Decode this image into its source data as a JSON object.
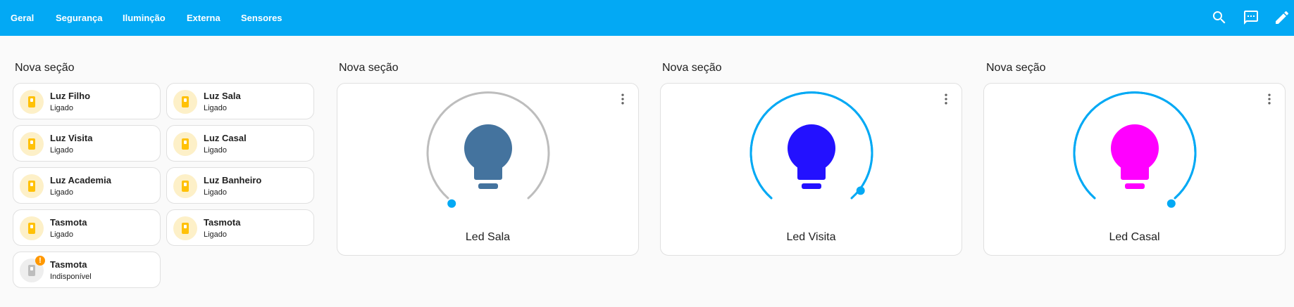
{
  "header": {
    "tabs": [
      {
        "label": "Geral"
      },
      {
        "label": "Segurança"
      },
      {
        "label": "Iluminção"
      },
      {
        "label": "Externa"
      },
      {
        "label": "Sensores"
      }
    ],
    "icons": [
      "search-icon",
      "chat-icon",
      "edit-pencil-icon"
    ]
  },
  "sections": [
    {
      "title": "Nova seção"
    },
    {
      "title": "Nova seção"
    },
    {
      "title": "Nova seção"
    },
    {
      "title": "Nova seção"
    }
  ],
  "tiles": [
    {
      "name": "Luz Filho",
      "state": "Ligado",
      "icon": "light-switch-icon"
    },
    {
      "name": "Luz Sala",
      "state": "Ligado",
      "icon": "light-switch-icon"
    },
    {
      "name": "Luz Visita",
      "state": "Ligado",
      "icon": "light-switch-icon"
    },
    {
      "name": "Luz Casal",
      "state": "Ligado",
      "icon": "light-switch-icon"
    },
    {
      "name": "Luz Academia",
      "state": "Ligado",
      "icon": "light-switch-icon"
    },
    {
      "name": "Luz Banheiro",
      "state": "Ligado",
      "icon": "light-switch-icon"
    },
    {
      "name": "Tasmota",
      "state": "Ligado",
      "icon": "light-switch-icon"
    },
    {
      "name": "Tasmota",
      "state": "Ligado",
      "icon": "light-switch-icon"
    },
    {
      "name": "Tasmota",
      "state": "Indisponível",
      "icon": "light-switch-icon",
      "badge": "!"
    }
  ],
  "lights": [
    {
      "name": "Led Sala",
      "bulb_color": "#44739e",
      "arc_color": "#bdbdbd",
      "brightness_pct": 0
    },
    {
      "name": "Led Visita",
      "bulb_color": "#2311ff",
      "arc_color": "#03a9f4",
      "brightness_pct": 94
    },
    {
      "name": "Led Casal",
      "bulb_color": "#ff00ff",
      "arc_color": "#03a9f4",
      "brightness_pct": 100
    }
  ],
  "colors": {
    "header": "#03a9f4",
    "tile_icon_on": "#ffc107",
    "tile_icon_off": "#bdbdbd",
    "warning_badge": "#ff9800"
  }
}
